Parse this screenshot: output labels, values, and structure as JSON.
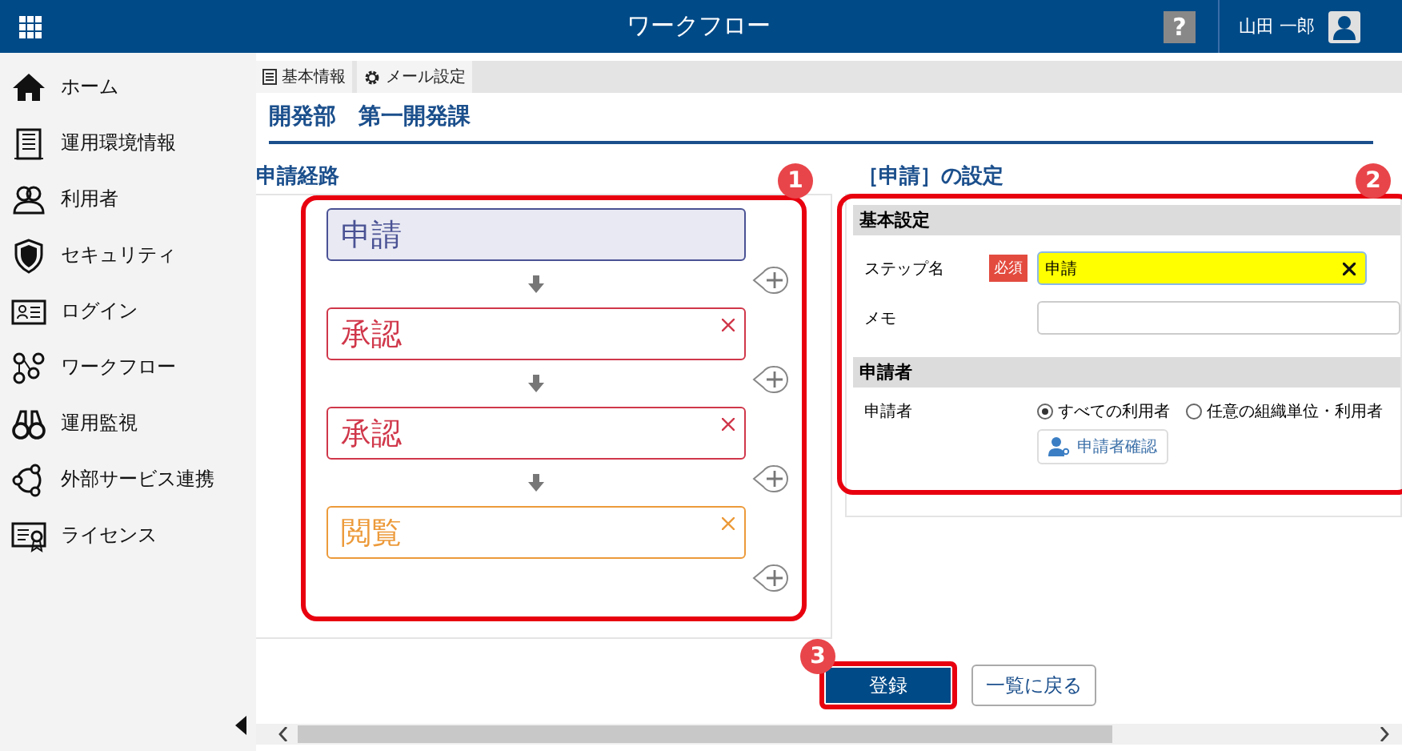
{
  "header": {
    "title": "ワークフロー",
    "help": "?",
    "user": "山田 一郎"
  },
  "sidebar": {
    "items": [
      {
        "label": "ホーム"
      },
      {
        "label": "運用環境情報"
      },
      {
        "label": "利用者"
      },
      {
        "label": "セキュリティ"
      },
      {
        "label": "ログイン"
      },
      {
        "label": "ワークフロー"
      },
      {
        "label": "運用監視"
      },
      {
        "label": "外部サービス連携"
      },
      {
        "label": "ライセンス"
      }
    ]
  },
  "tabs": [
    {
      "label": "基本情報"
    },
    {
      "label": "メール設定"
    }
  ],
  "page_title": "開発部　第一開発課",
  "route": {
    "heading": "申請経路",
    "steps": [
      {
        "label": "申請",
        "kind": "application",
        "removable": false
      },
      {
        "label": "承認",
        "kind": "approval",
        "removable": true
      },
      {
        "label": "承認",
        "kind": "approval",
        "removable": true
      },
      {
        "label": "閲覧",
        "kind": "view",
        "removable": true
      }
    ]
  },
  "settings": {
    "heading": "［申請］の設定",
    "basic": {
      "heading": "基本設定",
      "step_name": {
        "label": "ステップ名",
        "required": "必須",
        "value": "申請"
      },
      "memo": {
        "label": "メモ"
      }
    },
    "applicant": {
      "heading": "申請者",
      "label": "申請者",
      "options": [
        {
          "label": "すべての利用者",
          "selected": true
        },
        {
          "label": "任意の組織単位・利用者",
          "selected": false
        }
      ],
      "button": "申請者確認"
    }
  },
  "buttons": {
    "register": "登録",
    "back": "一覧に戻る"
  },
  "callouts": [
    "1",
    "2",
    "3"
  ]
}
